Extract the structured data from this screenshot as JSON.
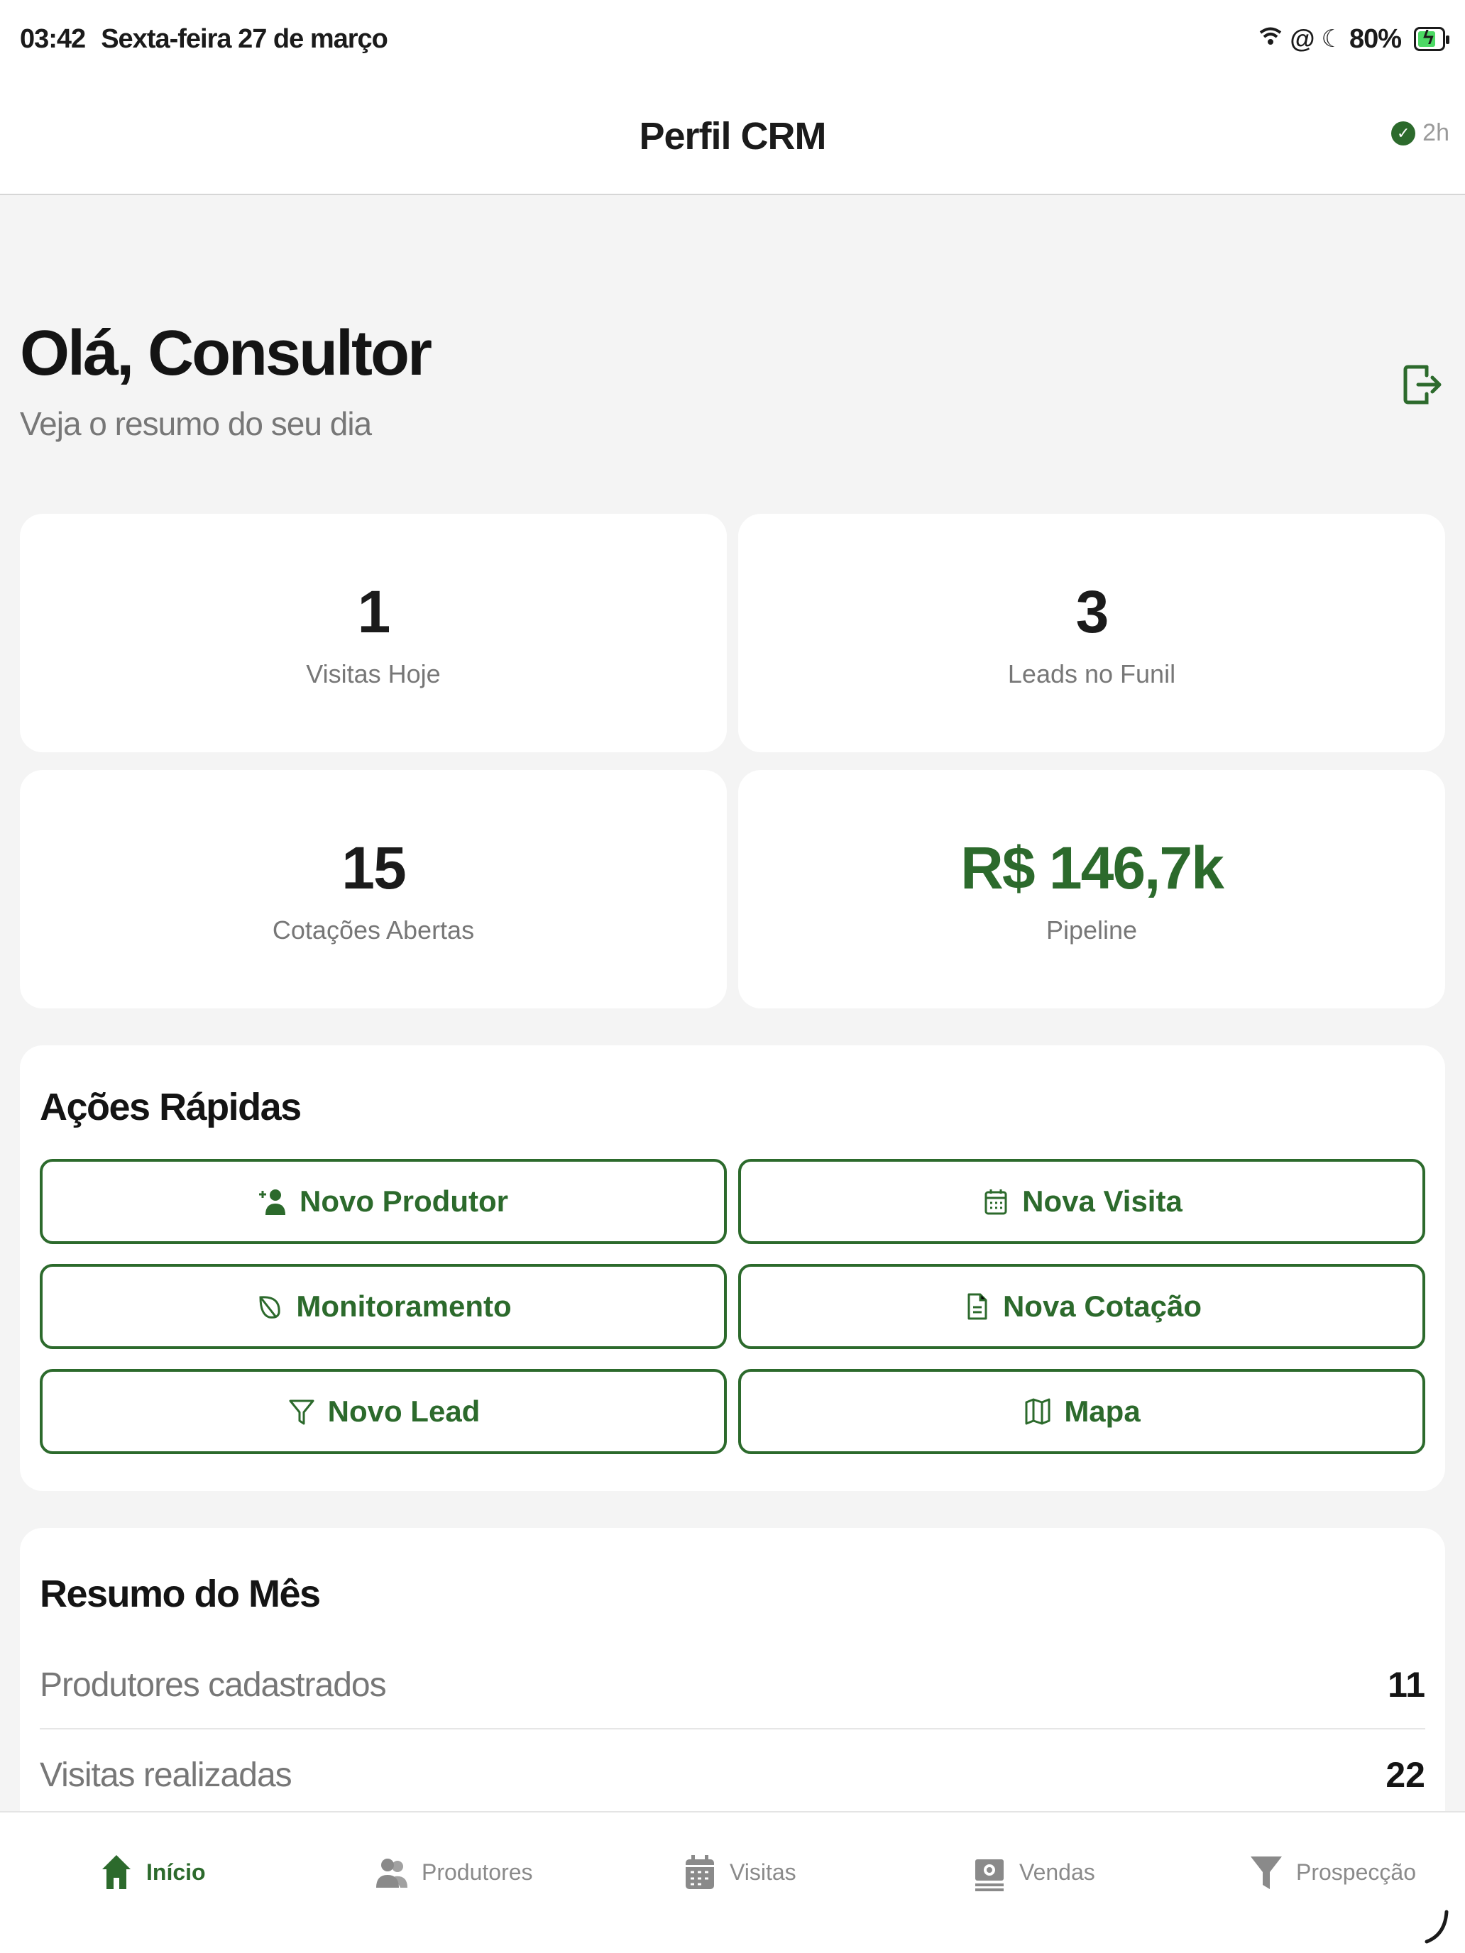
{
  "status": {
    "time": "03:42",
    "date": "Sexta-feira 27 de março",
    "battery": "80%",
    "battery_level": 0.8,
    "icons": [
      "wifi-icon",
      "at-icon",
      "moon-icon",
      "battery-icon"
    ]
  },
  "header": {
    "title": "Perfil CRM",
    "sync_label": "2h"
  },
  "greeting": {
    "title": "Olá, Consultor",
    "subtitle": "Veja o resumo do seu dia"
  },
  "stats": [
    {
      "value": "1",
      "label": "Visitas Hoje"
    },
    {
      "value": "3",
      "label": "Leads no Funil"
    },
    {
      "value": "15",
      "label": "Cotações Abertas"
    },
    {
      "value": "R$ 146,7k",
      "label": "Pipeline"
    }
  ],
  "quick_actions": {
    "title": "Ações Rápidas",
    "buttons": [
      {
        "label": "Novo Produtor",
        "icon": "user-plus-icon"
      },
      {
        "label": "Nova Visita",
        "icon": "calendar-icon"
      },
      {
        "label": "Monitoramento",
        "icon": "leaf-icon"
      },
      {
        "label": "Nova Cotação",
        "icon": "document-icon"
      },
      {
        "label": "Novo Lead",
        "icon": "filter-icon"
      },
      {
        "label": "Mapa",
        "icon": "map-icon"
      }
    ]
  },
  "summary": {
    "title": "Resumo do Mês",
    "rows": [
      {
        "label": "Produtores cadastrados",
        "value": "11"
      },
      {
        "label": "Visitas realizadas",
        "value": "22"
      }
    ]
  },
  "tabs": [
    {
      "label": "Início",
      "icon": "home-icon",
      "active": true
    },
    {
      "label": "Produtores",
      "icon": "users-icon",
      "active": false
    },
    {
      "label": "Visitas",
      "icon": "calendar-icon",
      "active": false
    },
    {
      "label": "Vendas",
      "icon": "money-icon",
      "active": false
    },
    {
      "label": "Prospecção",
      "icon": "funnel-icon",
      "active": false
    }
  ],
  "colors": {
    "accent": "#2c6a2c",
    "background": "#f4f4f4",
    "muted_text": "#777777"
  }
}
